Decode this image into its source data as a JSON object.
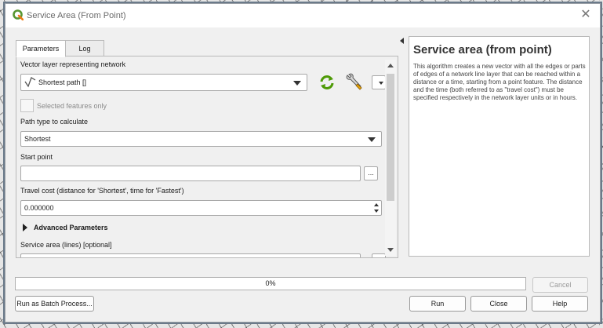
{
  "window": {
    "title": "Service Area (From Point)",
    "close_glyph": "✕"
  },
  "tabs": [
    {
      "label": "Parameters"
    },
    {
      "label": "Log"
    }
  ],
  "params": {
    "network_label": "Vector layer representing network",
    "network_value": "Shortest path []",
    "selected_only_label": "Selected features only",
    "path_type_label": "Path type to calculate",
    "path_type_value": "Shortest",
    "start_point_label": "Start point",
    "start_point_value": "",
    "browse_label": "...",
    "travel_cost_label": "Travel cost (distance for 'Shortest', time for 'Fastest')",
    "travel_cost_value": "0.000000",
    "advanced_label": "Advanced Parameters",
    "service_area_label": "Service area (lines) [optional]"
  },
  "help": {
    "title": "Service area (from point)",
    "body": "This algorithm creates a new vector with all the edges or parts of edges of a network line layer that can be reached within a distance or a time, starting from a point feature. The distance and the time (both referred to as \"travel cost\") must be specified respectively in the network layer units or in hours."
  },
  "progress": {
    "text": "0%",
    "value": 0
  },
  "buttons": {
    "cancel": "Cancel",
    "batch": "Run as Batch Process...",
    "run": "Run",
    "close": "Close",
    "help": "Help"
  },
  "colors": {
    "qgis_green": "#589632",
    "qgis_yellow": "#ee7913",
    "progress": "#3c8ddb"
  }
}
